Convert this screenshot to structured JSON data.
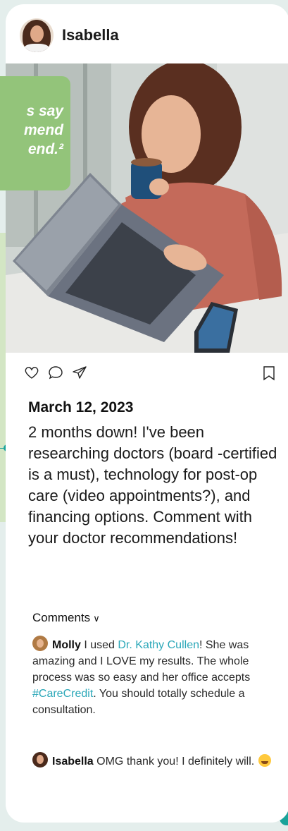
{
  "background": {
    "quote_text": "s say\nmend\nend.²"
  },
  "post": {
    "username": "Isabella",
    "date": "March 12, 2023",
    "body": "2 months down! I've been researching doctors (board -certified is a must), technology for post-op care (video appointments?), and financing options. Comment with your doctor recommendations!",
    "photo_icon": "woman-laptop-coffee-photo",
    "actions": [
      "heart-icon",
      "comment-icon",
      "send-icon",
      "bookmark-icon"
    ]
  },
  "comments": {
    "title": "Comments",
    "toggle": "∨",
    "items": [
      {
        "author": "Molly",
        "text_before": " I used ",
        "link": "Dr. Kathy Cullen",
        "text_mid": "! She was amazing and I LOVE my results. The whole process was so easy and her office accepts ",
        "hashtag": "#CareCredit",
        "text_after": ". You should totally schedule a consultation."
      },
      {
        "author": "Isabella",
        "text": " OMG thank you! I definitely will.",
        "emoji": "hugging-face-emoji"
      }
    ]
  },
  "colors": {
    "accent_teal": "#1aa39a",
    "green_panel": "#93c47a",
    "link": "#2aa7b8"
  }
}
